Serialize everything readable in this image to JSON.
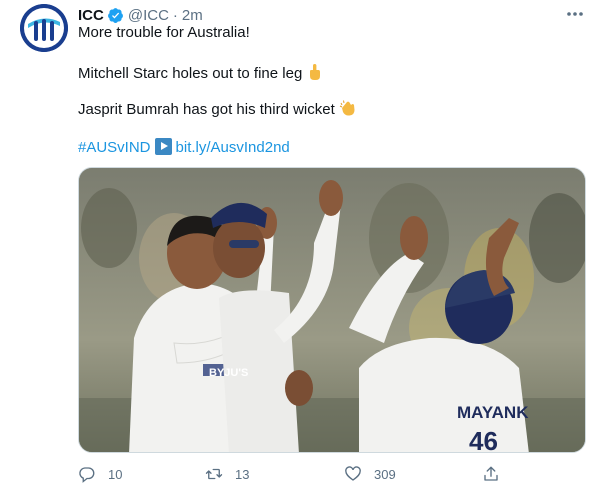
{
  "author": {
    "name": "ICC",
    "handle": "@ICC",
    "separator": "·",
    "time": "2m",
    "avatar_icon": "icc-logo-icon",
    "verified_icon": "verified-badge-icon"
  },
  "tweet": {
    "line1": "More trouble for Australia!",
    "line2": "Mitchell Starc holes out to fine leg",
    "line2_emoji": "pointing-up-icon",
    "line3": "Jasprit Bumrah has got his third wicket",
    "line3_emoji": "clapping-hands-icon",
    "hashtag": "#AUSvIND",
    "link_icon": "play-button-icon",
    "link": "bit.ly/AusvInd2nd"
  },
  "media": {
    "jersey_text": "MAYANK",
    "jersey_number": "46",
    "shirt_sponsor": "BYJU'S"
  },
  "actions": {
    "reply_count": "10",
    "retweet_count": "13",
    "like_count": "309"
  },
  "colors": {
    "link": "#1b95e0",
    "secondary_text": "#5b7083",
    "verified": "#1da1f2"
  }
}
